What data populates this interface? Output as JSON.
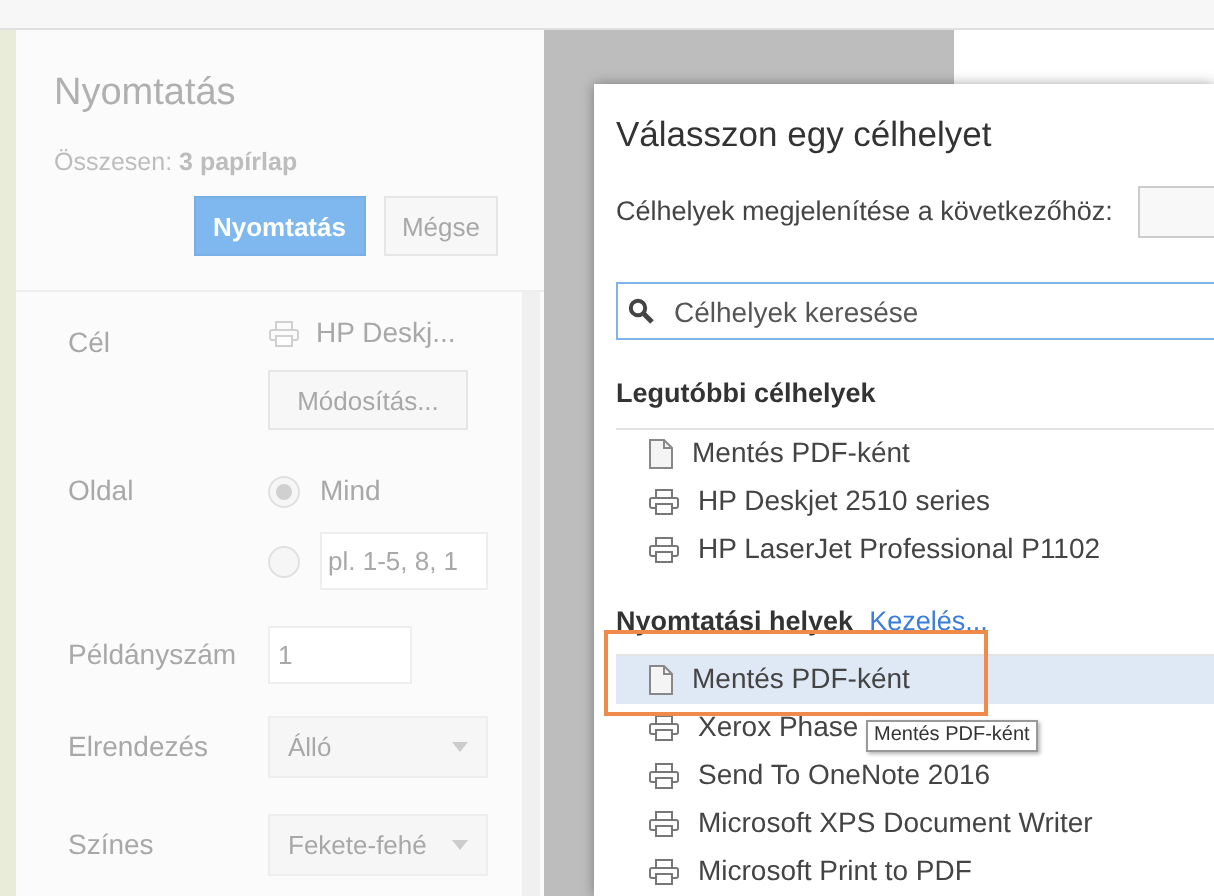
{
  "print_panel": {
    "title": "Nyomtatás",
    "summary": "Összesen: **3 papírlap**",
    "buttons": [
      {
        "label": "Nyomtatás",
        "kind": "primary"
      },
      {
        "label": "Mégse",
        "kind": "secondary"
      }
    ],
    "destination": {
      "label": "Cél",
      "printer": "HP Deskj...",
      "change_button": "Módosítás..."
    },
    "pages": {
      "label": "Oldal",
      "options": [
        {
          "label": "Mind",
          "selected": true
        },
        {
          "placeholder": "pl. 1-5, 8, 1",
          "selected": false
        }
      ]
    },
    "copies": {
      "label": "Példányszám",
      "value": "1"
    },
    "layout": {
      "label": "Elrendezés",
      "value": "Álló"
    },
    "color": {
      "label": "Színes",
      "value": "Fekete-fehé"
    }
  },
  "dialog": {
    "title": "Válasszon egy célhelyet",
    "filter_label": "Célhelyek megjelenítése a következőhöz:",
    "search": {
      "placeholder": "Célhelyek keresése"
    },
    "sections": [
      {
        "title": "Legutóbbi célhelyek",
        "items": [
          {
            "name": "Mentés PDF-ként",
            "kind": "pdf",
            "selected": false
          },
          {
            "name": "HP Deskjet 2510 series",
            "kind": "printer",
            "selected": false
          },
          {
            "name": "HP LaserJet Professional P1102",
            "kind": "printer",
            "selected": false
          }
        ]
      },
      {
        "title": "Nyomtatási helyek",
        "link": "Kezelés...",
        "items": [
          {
            "name": "Mentés PDF-ként",
            "kind": "pdf",
            "selected": true
          },
          {
            "name": "Xerox Phase",
            "kind": "printer",
            "selected": false
          },
          {
            "name": "Send To OneNote 2016",
            "kind": "printer",
            "selected": false
          },
          {
            "name": "Microsoft XPS Document Writer",
            "kind": "printer",
            "selected": false
          },
          {
            "name": "Microsoft Print to PDF",
            "kind": "printer",
            "selected": false
          }
        ]
      }
    ],
    "tooltip": "Mentés PDF-ként"
  }
}
